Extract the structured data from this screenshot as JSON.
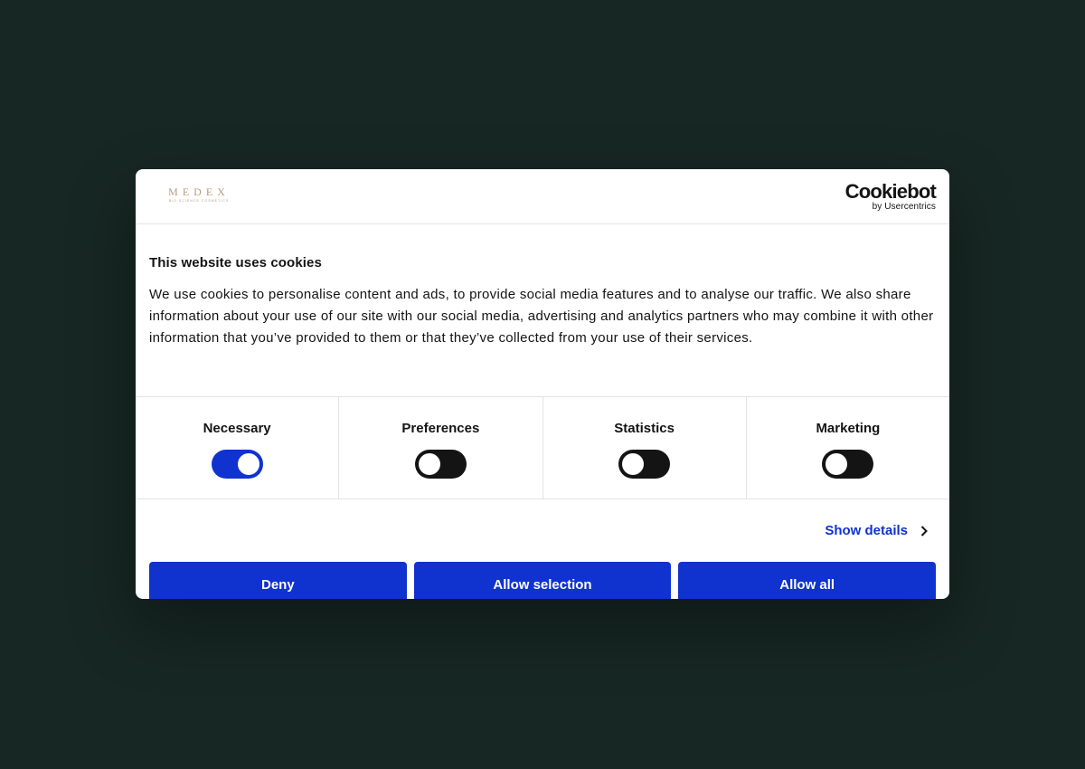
{
  "brand": {
    "logo_icon": "medex-logo",
    "logo_text": "MEDEX",
    "logo_tagline": "BIO SCIENCE COSMETICS",
    "logo_color": "#b39c7d"
  },
  "provider": {
    "name": "Cookiebot",
    "byline": "by Usercentrics"
  },
  "consent": {
    "title": "This website uses cookies",
    "text": "We use cookies to personalise content and ads, to provide social media features and to analyse our traffic. We also share information about your use of our site with our social media, advertising and analytics partners who may combine it with other information that you’ve provided to them or that they’ve collected from your use of their services."
  },
  "toggles": [
    {
      "label": "Necessary",
      "checked": true
    },
    {
      "label": "Preferences",
      "checked": false
    },
    {
      "label": "Statistics",
      "checked": false
    },
    {
      "label": "Marketing",
      "checked": false
    }
  ],
  "details": {
    "label": "Show details",
    "icon": "chevron-right-icon"
  },
  "buttons": {
    "deny": "Deny",
    "allow_selection": "Allow selection",
    "allow_all": "Allow all"
  },
  "colors": {
    "page_background": "#172723",
    "accent": "#1032cf",
    "text": "#141414",
    "toggle_off": "#141414"
  }
}
